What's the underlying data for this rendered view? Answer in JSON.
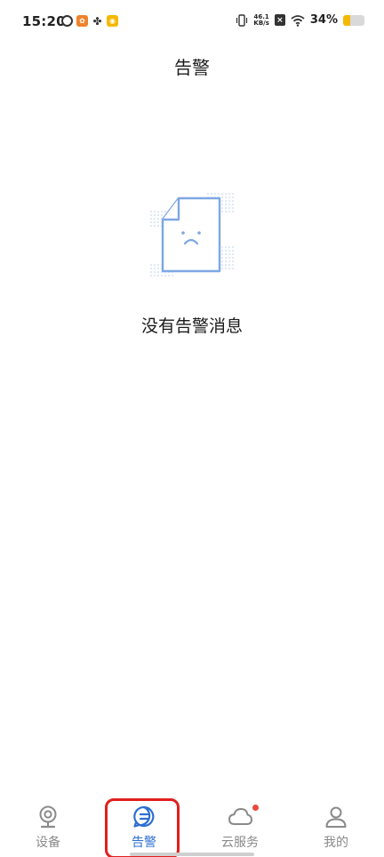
{
  "status_bar": {
    "time": "15:20",
    "network_speed_value": "46.1",
    "network_speed_unit": "KB/s",
    "battery_percent_text": "34%",
    "battery_level": 0.34,
    "app_icons": [
      "swirl-app-icon",
      "orange-app-icon",
      "pinwheel-app-icon",
      "weibo-icon"
    ]
  },
  "header": {
    "title": "告警"
  },
  "empty_state": {
    "message": "没有告警消息",
    "icon": "sad-document-icon",
    "accent_color": "#7ea7e4"
  },
  "bottom_nav": {
    "items": [
      {
        "label": "设备",
        "icon": "camera-icon",
        "active": false,
        "badge": false
      },
      {
        "label": "告警",
        "icon": "message-bubble-icon",
        "active": true,
        "badge": false
      },
      {
        "label": "云服务",
        "icon": "cloud-icon",
        "active": false,
        "badge": true
      },
      {
        "label": "我的",
        "icon": "person-icon",
        "active": false,
        "badge": false
      }
    ],
    "active_color": "#2d6fd1",
    "inactive_color": "#8a8a8a",
    "badge_color": "#e84a3c",
    "highlight_color": "#e0201e"
  }
}
